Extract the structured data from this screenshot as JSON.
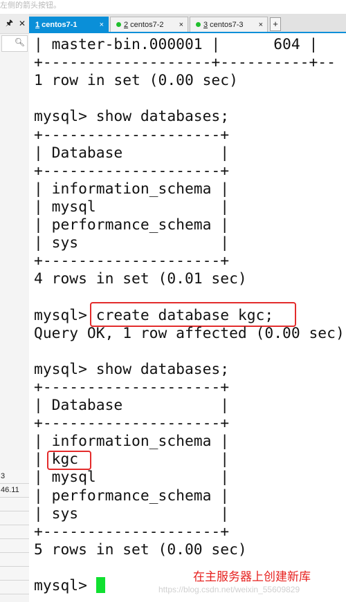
{
  "hint_bar": {
    "text": "左侧的箭头按钮。"
  },
  "sidebar": {
    "pin_icon": "pushpin-icon",
    "close_icon": "close-icon",
    "search_icon": "search-icon",
    "rows": [
      "3",
      "46.11",
      "",
      "",
      "",
      "",
      "",
      "",
      ""
    ]
  },
  "tabs": [
    {
      "index": "1",
      "label": " centos7-1",
      "active": true,
      "status": "connected"
    },
    {
      "index": "2",
      "label": " centos7-2",
      "active": false,
      "status": "connected"
    },
    {
      "index": "3",
      "label": " centos7-3",
      "active": false,
      "status": "connected"
    }
  ],
  "tab_close_symbol": "×",
  "tab_add_symbol": "+",
  "terminal": {
    "lines": [
      "| master-bin.000001 |      604 | ",
      "+-------------------+----------+--",
      "1 row in set (0.00 sec)",
      "",
      "mysql> show databases;",
      "+--------------------+",
      "| Database           |",
      "+--------------------+",
      "| information_schema |",
      "| mysql              |",
      "| performance_schema |",
      "| sys                |",
      "+--------------------+",
      "4 rows in set (0.01 sec)",
      "",
      "mysql> create database kgc;",
      "Query OK, 1 row affected (0.00 sec)",
      "",
      "mysql> show databases;",
      "+--------------------+",
      "| Database           |",
      "+--------------------+",
      "| information_schema |",
      "| kgc                |",
      "| mysql              |",
      "| performance_schema |",
      "| sys                |",
      "+--------------------+",
      "5 rows in set (0.00 sec)",
      "",
      "mysql> "
    ]
  },
  "annotation": "在主服务器上创建新库",
  "watermark": "https://blog.csdn.net/weixin_55609829",
  "colors": {
    "accent": "#0a8fd8",
    "highlight": "#e32b2b",
    "cursor": "#10e030",
    "status_dot": "#1fbf2c"
  }
}
